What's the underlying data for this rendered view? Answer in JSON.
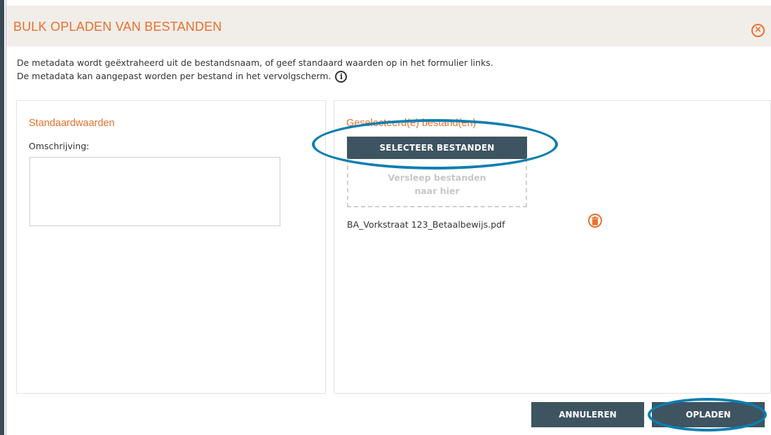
{
  "dialog": {
    "title": "BULK OPLADEN VAN BESTANDEN",
    "close_icon": "close-circle-icon",
    "intro_line1": "De metadata wordt geëxtraheerd uit de bestandsnaam, of geef standaard waarden op in het formulier links.",
    "intro_line2": "De metadata kan aangepast worden per bestand in het vervolgscherm.",
    "info_icon": "info-circle-icon",
    "info_glyph": "i",
    "close_glyph": "×"
  },
  "left_panel": {
    "title": "Standaardwaarden",
    "description_label": "Omschrijving:",
    "description_value": ""
  },
  "right_panel": {
    "title": "Geselecteerd(e) bestand(en)",
    "select_button": "SELECTEER BESTANDEN",
    "dropzone_line1": "Versleep bestanden",
    "dropzone_line2": "naar hier",
    "files": [
      {
        "name": "BA_Vorkstraat 123_Betaalbewijs.pdf",
        "delete_icon": "trash-icon"
      }
    ]
  },
  "footer": {
    "cancel_label": "ANNULEREN",
    "upload_label": "OPLADEN"
  },
  "colors": {
    "accent": "#e8712b",
    "button_bg": "#3e5461",
    "header_bg": "#f1ede9",
    "highlight": "#0c7eb0"
  }
}
